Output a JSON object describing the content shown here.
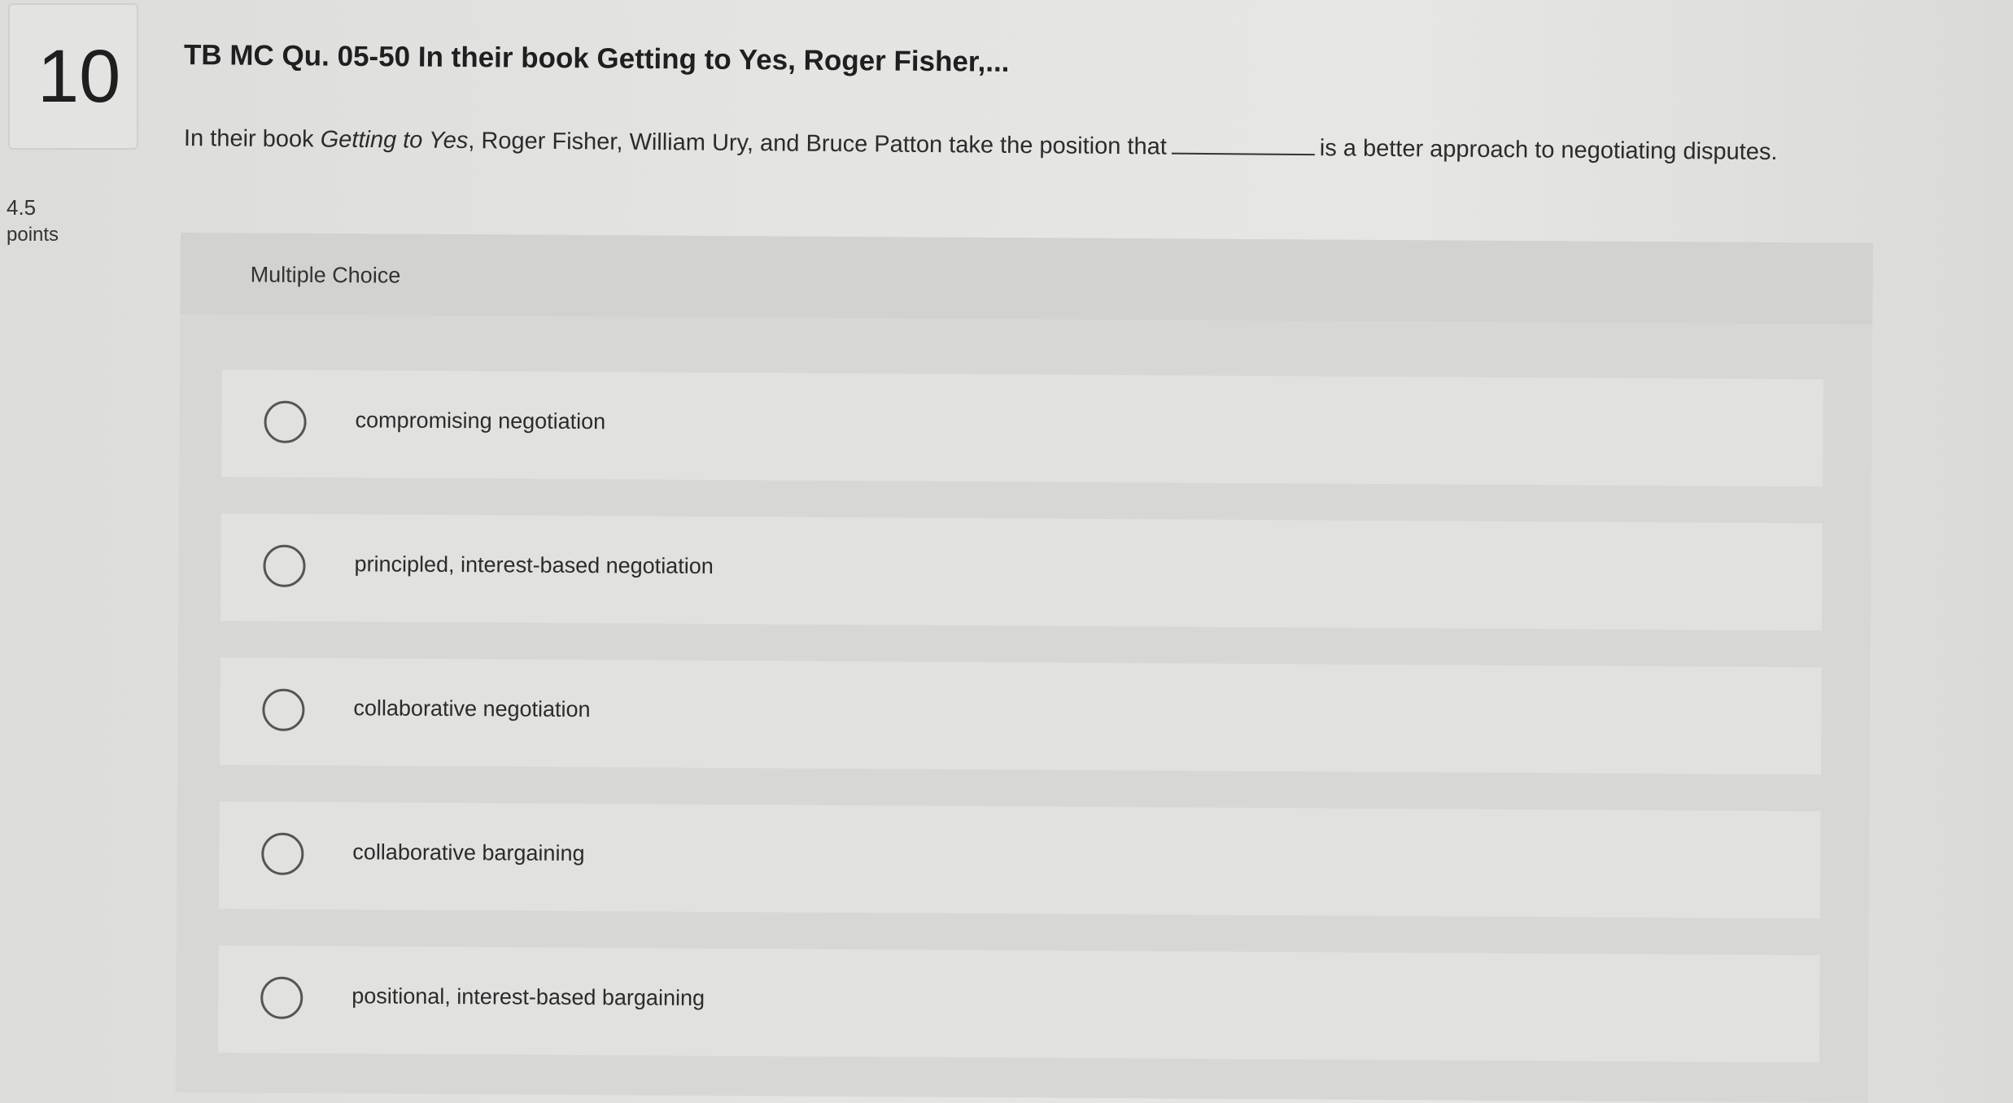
{
  "question": {
    "number": "10",
    "points_value": "4.5",
    "points_unit": "points",
    "title": "TB MC Qu. 05-50 In their book Getting to Yes, Roger Fisher,...",
    "text_before_book": "In their book ",
    "book_title": "Getting to Yes",
    "text_after_book": ", Roger Fisher, William Ury, and Bruce Patton take the position that",
    "text_after_blank": "is a better approach to negotiating disputes."
  },
  "multiple_choice": {
    "label": "Multiple Choice",
    "options": [
      {
        "label": "compromising negotiation"
      },
      {
        "label": "principled, interest-based negotiation"
      },
      {
        "label": "collaborative negotiation"
      },
      {
        "label": "collaborative bargaining"
      },
      {
        "label": "positional, interest-based bargaining"
      }
    ]
  }
}
